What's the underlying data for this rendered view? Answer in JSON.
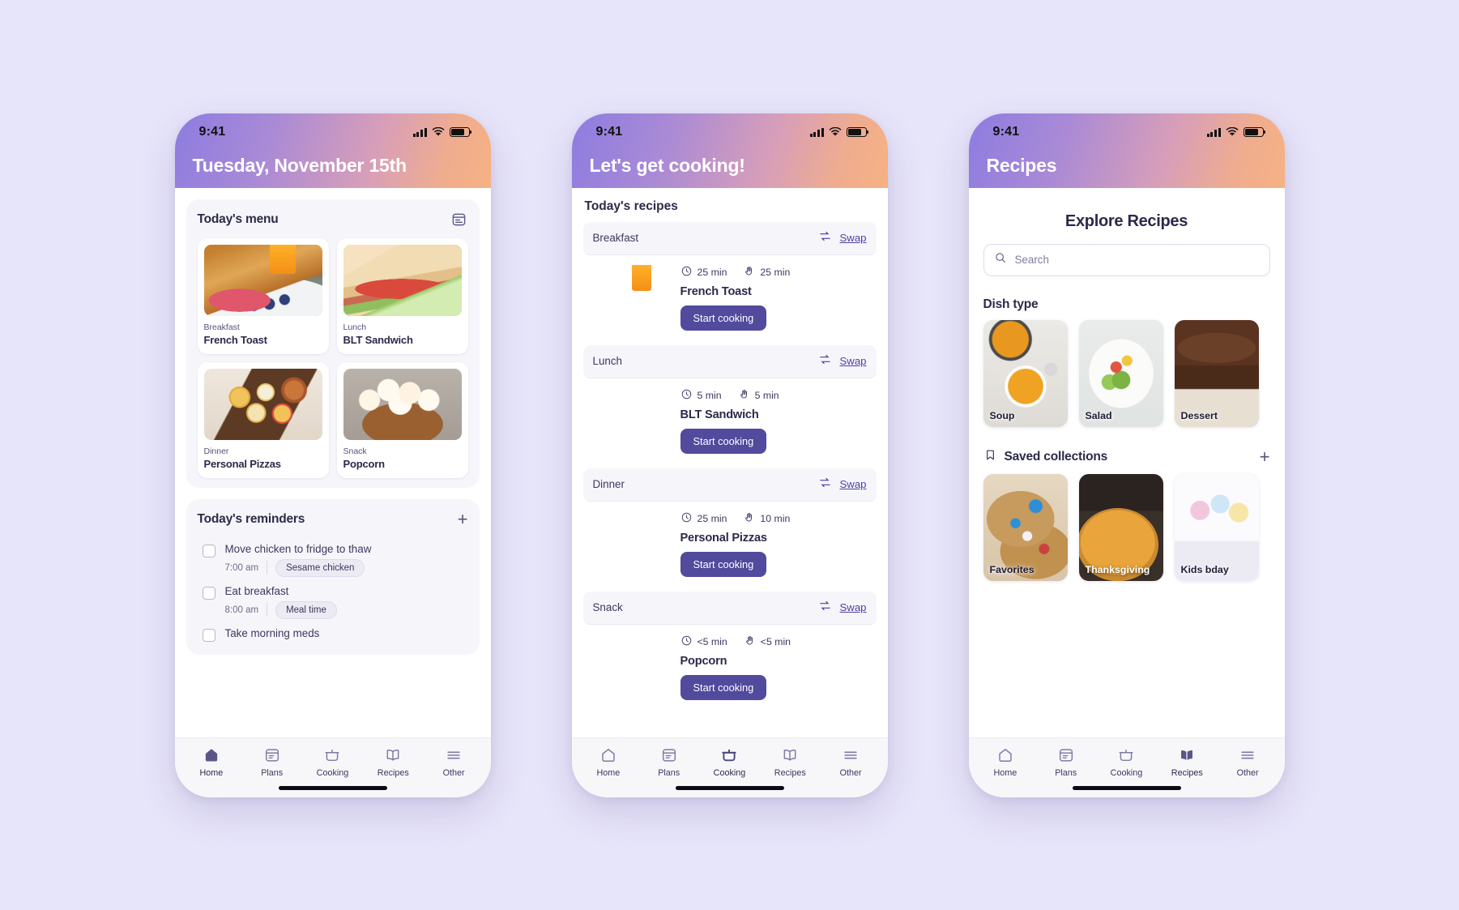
{
  "status_bar": {
    "time": "9:41"
  },
  "phone1": {
    "header_title": "Tuesday, November 15th",
    "menu_panel": {
      "title": "Today's menu",
      "action_icon": "calendar-icon",
      "meals": [
        {
          "kicker": "Breakfast",
          "name": "French Toast",
          "art": "art-french"
        },
        {
          "kicker": "Lunch",
          "name": "BLT Sandwich",
          "art": "art-blt"
        },
        {
          "kicker": "Dinner",
          "name": "Personal Pizzas",
          "art": "art-pizza"
        },
        {
          "kicker": "Snack",
          "name": "Popcorn",
          "art": "art-popcorn"
        }
      ]
    },
    "reminders_panel": {
      "title": "Today's reminders",
      "add_label": "+",
      "items": [
        {
          "title": "Move chicken to fridge to thaw",
          "time": "7:00 am",
          "tag": "Sesame chicken"
        },
        {
          "title": "Eat breakfast",
          "time": "8:00 am",
          "tag": "Meal time"
        },
        {
          "title": "Take morning meds",
          "time": "",
          "tag": ""
        }
      ]
    },
    "tabs": [
      {
        "label": "Home",
        "icon": "home-icon",
        "active": true
      },
      {
        "label": "Plans",
        "icon": "calendar-icon",
        "active": false
      },
      {
        "label": "Cooking",
        "icon": "pot-icon",
        "active": false
      },
      {
        "label": "Recipes",
        "icon": "book-icon",
        "active": false
      },
      {
        "label": "Other",
        "icon": "menu-icon",
        "active": false
      }
    ]
  },
  "phone2": {
    "header_title": "Let's get cooking!",
    "section_title": "Today's recipes",
    "swap_label": "Swap",
    "start_label": "Start cooking",
    "meals": [
      {
        "slot": "Breakfast",
        "name": "French Toast",
        "prep_time": "25 min",
        "cook_time": "25 min",
        "art": "art-french"
      },
      {
        "slot": "Lunch",
        "name": "BLT Sandwich",
        "prep_time": "5 min",
        "cook_time": "5 min",
        "art": "art-blt"
      },
      {
        "slot": "Dinner",
        "name": "Personal Pizzas",
        "prep_time": "25 min",
        "cook_time": "10 min",
        "art": "art-pizza"
      },
      {
        "slot": "Snack",
        "name": "Popcorn",
        "prep_time": "<5 min",
        "cook_time": "<5 min",
        "art": "art-popcorn"
      }
    ],
    "tabs": [
      {
        "label": "Home",
        "icon": "home-icon",
        "active": false
      },
      {
        "label": "Plans",
        "icon": "calendar-icon",
        "active": false
      },
      {
        "label": "Cooking",
        "icon": "pot-icon",
        "active": true
      },
      {
        "label": "Recipes",
        "icon": "book-icon",
        "active": false
      },
      {
        "label": "Other",
        "icon": "menu-icon",
        "active": false
      }
    ]
  },
  "phone3": {
    "header_title": "Recipes",
    "page_title": "Explore Recipes",
    "search_placeholder": "Search",
    "dish_type": {
      "title": "Dish type",
      "tiles": [
        {
          "label": "Soup",
          "art": "art-soup",
          "light": false
        },
        {
          "label": "Salad",
          "art": "art-salad",
          "light": false
        },
        {
          "label": "Dessert",
          "art": "art-dessert",
          "light": false
        }
      ]
    },
    "saved_collections": {
      "title": "Saved collections",
      "icon": "bookmark-icon",
      "add_label": "+",
      "tiles": [
        {
          "label": "Favorites",
          "art": "art-cookies",
          "light": false
        },
        {
          "label": "Thanksgiving",
          "art": "art-thanks",
          "light": true
        },
        {
          "label": "Kids bday",
          "art": "art-kids",
          "light": false
        }
      ]
    },
    "tabs": [
      {
        "label": "Home",
        "icon": "home-icon",
        "active": false
      },
      {
        "label": "Plans",
        "icon": "calendar-icon",
        "active": false
      },
      {
        "label": "Cooking",
        "icon": "pot-icon",
        "active": false
      },
      {
        "label": "Recipes",
        "icon": "book-icon",
        "active": true
      },
      {
        "label": "Other",
        "icon": "menu-icon",
        "active": false
      }
    ]
  },
  "colors": {
    "background": "#e7e5fa",
    "accent": "#514a9d",
    "link": "#4b3fa7",
    "header_gradient_start": "#8d7ce0",
    "header_gradient_end": "#f6b183"
  }
}
